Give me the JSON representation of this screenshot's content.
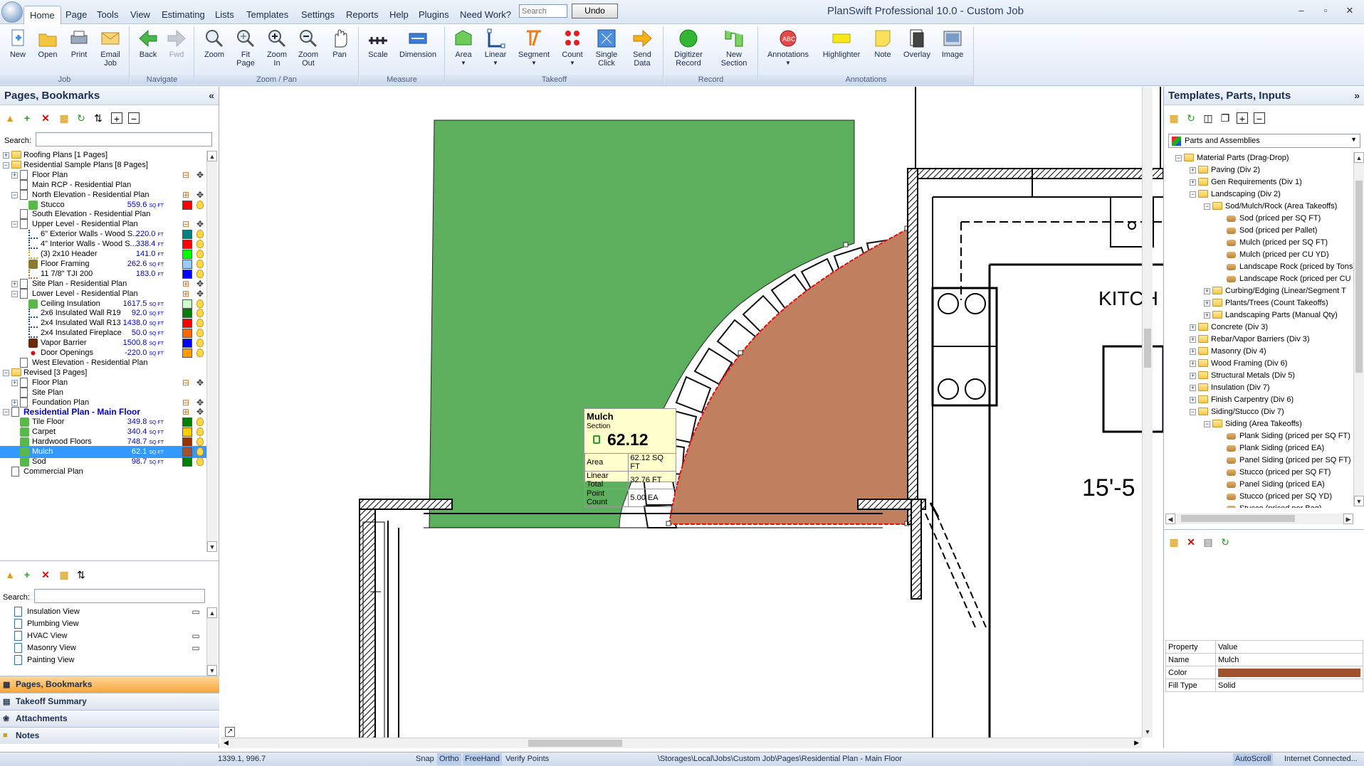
{
  "app": {
    "title": "PlanSwift Professional 10.0 - Custom Job"
  },
  "menu": [
    "Home",
    "Page",
    "Tools",
    "View",
    "Estimating",
    "Lists",
    "Templates",
    "Settings",
    "Reports",
    "Help",
    "Plugins",
    "Need Work?"
  ],
  "search": {
    "placeholder": "Search"
  },
  "undo_label": "Undo",
  "ribbon": {
    "groups": [
      "Job",
      "Navigate",
      "Zoom / Pan",
      "Measure",
      "Takeoff",
      "Record",
      "Annotations"
    ],
    "buttons": [
      "New",
      "Open",
      "Print",
      "Email\nJob",
      "Back",
      "Fwd",
      "Zoom",
      "Fit\nPage",
      "Zoom\nIn",
      "Zoom\nOut",
      "Pan",
      "Scale",
      "Dimension",
      "Area",
      "Linear",
      "Segment",
      "Count",
      "Single\nClick",
      "Send\nData",
      "Digitizer\nRecord",
      "New\nSection",
      "Annotations",
      "Highlighter",
      "Note",
      "Overlay",
      "Image"
    ]
  },
  "left": {
    "title": "Pages, Bookmarks",
    "search_label": "Search:",
    "tree": [
      {
        "label": "Roofing Plans [1 Pages]"
      },
      {
        "label": "Residential Sample Plans [8 Pages]"
      },
      {
        "label": "Floor Plan"
      },
      {
        "label": "Main RCP - Residential Plan"
      },
      {
        "label": "North Elevation - Residential Plan"
      },
      {
        "label": "Stucco",
        "value": "559.6",
        "unit": "SQ FT"
      },
      {
        "label": "South Elevation - Residential Plan"
      },
      {
        "label": "Upper Level - Residential Plan"
      },
      {
        "label": "6\" Exterior Walls - Wood S...",
        "value": "220.0",
        "unit": "FT"
      },
      {
        "label": "4\" Interior Walls - Wood S...",
        "value": "338.4",
        "unit": "FT"
      },
      {
        "label": "(3) 2x10 Header",
        "value": "141.0",
        "unit": "FT"
      },
      {
        "label": "Floor Framing",
        "value": "262.6",
        "unit": "SQ FT"
      },
      {
        "label": "11 7/8\" TJI 200",
        "value": "183.0",
        "unit": "FT"
      },
      {
        "label": "Site Plan - Residential Plan"
      },
      {
        "label": "Lower Level - Residential Plan"
      },
      {
        "label": "Ceiling Insulation",
        "value": "1617.5",
        "unit": "SQ FT"
      },
      {
        "label": "2x6 Insulated Wall R19",
        "value": "92.0",
        "unit": "SQ FT"
      },
      {
        "label": "2x4 Insulated Wall R13",
        "value": "1438.0",
        "unit": "SQ FT"
      },
      {
        "label": "2x4 Insulated Fireplace",
        "value": "50.0",
        "unit": "SQ FT"
      },
      {
        "label": "Vapor Barrier",
        "value": "1500.8",
        "unit": "SQ FT"
      },
      {
        "label": "Door Openings",
        "value": "-220.0",
        "unit": "SQ FT"
      },
      {
        "label": "West Elevation - Residential Plan"
      },
      {
        "label": "Revised [3 Pages]"
      },
      {
        "label": "Floor Plan"
      },
      {
        "label": "Site Plan"
      },
      {
        "label": "Foundation Plan"
      },
      {
        "label": "Residential Plan - Main Floor"
      },
      {
        "label": "Tile Floor",
        "value": "349.8",
        "unit": "SQ FT"
      },
      {
        "label": "Carpet",
        "value": "340.4",
        "unit": "SQ FT"
      },
      {
        "label": "Hardwood Floors",
        "value": "748.7",
        "unit": "SQ FT"
      },
      {
        "label": "Mulch",
        "value": "62.1",
        "unit": "SQ FT"
      },
      {
        "label": "Sod",
        "value": "98.7",
        "unit": "SQ FT"
      },
      {
        "label": "Commercial Plan"
      }
    ],
    "views": [
      "Insulation View",
      "Plumbing View",
      "HVAC View",
      "Masonry View",
      "Painting View"
    ],
    "nav": [
      "Pages, Bookmarks",
      "Takeoff Summary",
      "Attachments",
      "Notes"
    ]
  },
  "canvas": {
    "tooltip": {
      "title": "Mulch",
      "subtitle": "Section",
      "value": "62.12",
      "rows": [
        [
          "Area",
          "62.12 SQ FT"
        ],
        [
          "Linear Total",
          "32.76 FT"
        ],
        [
          "Point Count",
          "5.00 EA"
        ]
      ]
    },
    "text_kitchen": "KITCH",
    "text_dim": "15'-5 ''"
  },
  "right": {
    "title": "Templates, Parts, Inputs",
    "dropdown": "Parts and Assemblies",
    "tree": [
      "Material Parts (Drag-Drop)",
      "Paving (Div 2)",
      "Gen Requirements (Div 1)",
      "Landscaping (Div 2)",
      "Sod/Mulch/Rock (Area Takeoffs)",
      "Sod (priced per SQ FT)",
      "Sod (priced per Pallet)",
      "Mulch (priced per SQ FT)",
      "Mulch (priced per CU YD)",
      "Landscape Rock (priced by Tons)",
      "Landscape Rock (priced per CU YD",
      "Curbing/Edging (Linear/Segment T",
      "Plants/Trees (Count Takeoffs)",
      "Landscaping Parts (Manual Qty)",
      "Concrete (Div 3)",
      "Rebar/Vapor Barriers (Div 3)",
      "Masonry (Div 4)",
      "Wood Framing (Div 6)",
      "Structural Metals (Div 5)",
      "Insulation (Div 7)",
      "Finish Carpentry (Div 6)",
      "Siding/Stucco (Div 7)",
      "Siding (Area Takeoffs)",
      "Plank Siding (priced per SQ FT)",
      "Plank Siding (priced EA)",
      "Panel Siding (priced per SQ FT)",
      "Stucco (priced per SQ FT)",
      "Panel Siding (priced EA)",
      "Stucco (priced per SQ YD)",
      "Stucco (priced per Bag)"
    ],
    "props": {
      "header": [
        "Property",
        "Value"
      ],
      "rows": [
        [
          "Name",
          "Mulch"
        ],
        [
          "Color",
          ""
        ],
        [
          "Fill Type",
          "Solid"
        ]
      ]
    }
  },
  "status": {
    "coords": "1339.1, 996.7",
    "items": [
      "Snap",
      "Ortho",
      "FreeHand",
      "Verify Points"
    ],
    "path": "\\Storages\\Local\\Jobs\\Custom Job\\Pages\\Residential Plan - Main Floor",
    "right": [
      "AutoScroll",
      "Internet Connected..."
    ]
  },
  "colors": {
    "mulch": "#a0522d",
    "sod_green": "#5caf5c",
    "mulch_fill": "#c08060"
  }
}
